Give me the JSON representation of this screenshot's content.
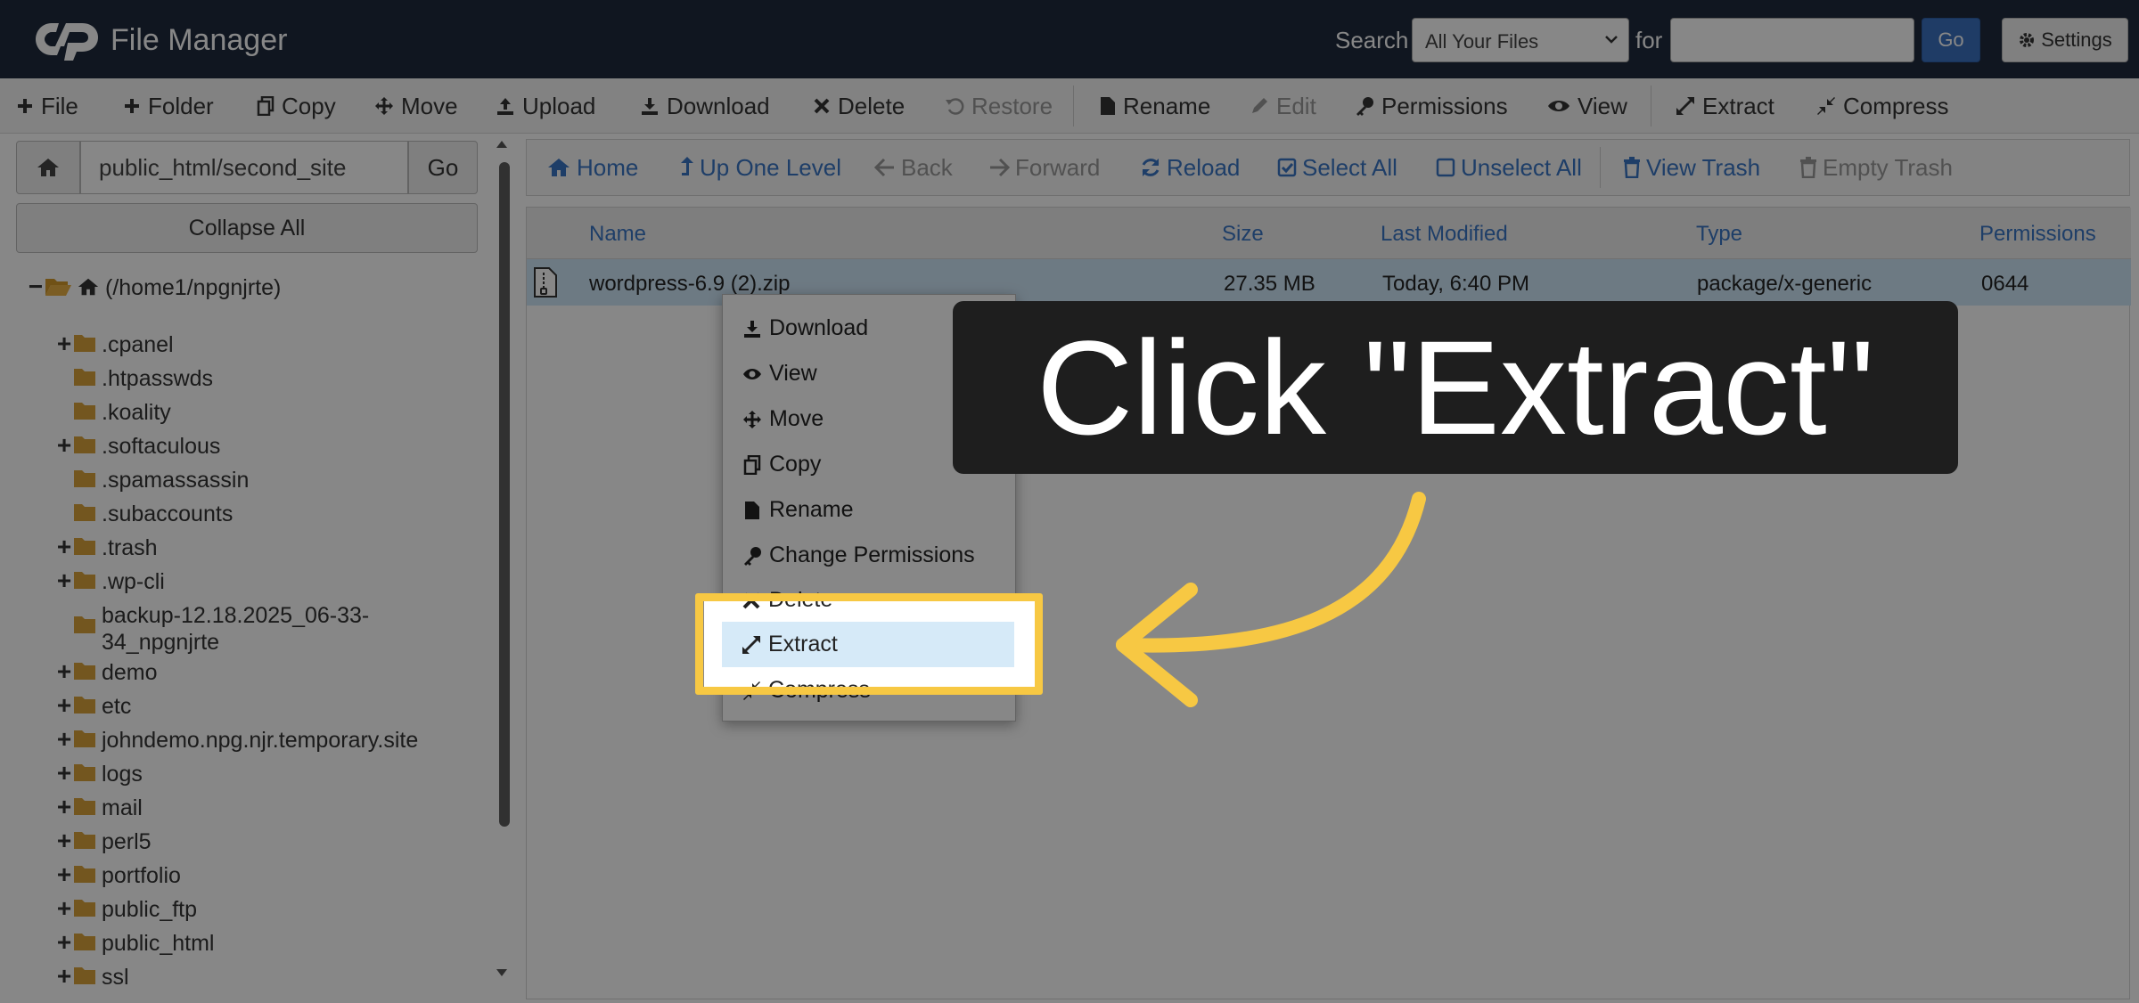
{
  "header": {
    "app_title": "File Manager",
    "search_label": "Search",
    "search_scope": "All Your Files",
    "for_label": "for",
    "search_value": "",
    "go_label": "Go",
    "settings_label": "Settings"
  },
  "toolbar": {
    "file": "File",
    "folder": "Folder",
    "copy": "Copy",
    "move": "Move",
    "upload": "Upload",
    "download": "Download",
    "delete": "Delete",
    "restore": "Restore",
    "rename": "Rename",
    "edit": "Edit",
    "permissions": "Permissions",
    "view": "View",
    "extract": "Extract",
    "compress": "Compress"
  },
  "left": {
    "path": "public_html/second_site",
    "go_label": "Go",
    "collapse_all": "Collapse All",
    "tree_root": "(/home1/npgnjrte)",
    "tree": [
      ".cpanel",
      ".htpasswds",
      ".koality",
      ".softaculous",
      ".spamassassin",
      ".subaccounts",
      ".trash",
      ".wp-cli",
      "backup-12.18.2025_06-33-",
      "34_npgnjrte",
      "demo",
      "etc",
      "johndemo.npg.njr.temporary.site",
      "logs",
      "mail",
      "perl5",
      "portfolio",
      "public_ftp",
      "public_html",
      "ssl"
    ]
  },
  "nav": {
    "home": "Home",
    "up": "Up One Level",
    "back": "Back",
    "forward": "Forward",
    "reload": "Reload",
    "select_all": "Select All",
    "unselect_all": "Unselect All",
    "view_trash": "View Trash",
    "empty_trash": "Empty Trash"
  },
  "table": {
    "columns": [
      "Name",
      "Size",
      "Last Modified",
      "Type",
      "Permissions"
    ],
    "rows": [
      {
        "name": "wordpress-6.9 (2).zip",
        "size": "27.35 MB",
        "modified": "Today, 6:40 PM",
        "type": "package/x-generic",
        "perms": "0644"
      }
    ]
  },
  "context_menu": [
    "Download",
    "View",
    "Move",
    "Copy",
    "Rename",
    "Change Permissions",
    "Delete",
    "Extract",
    "Compress"
  ],
  "callout": {
    "text": "Click \"Extract\""
  },
  "colors": {
    "header_bg": "#1f2b3e",
    "link": "#3a75c4",
    "highlight": "#f7c843",
    "row_selected": "#cfe6f7"
  }
}
